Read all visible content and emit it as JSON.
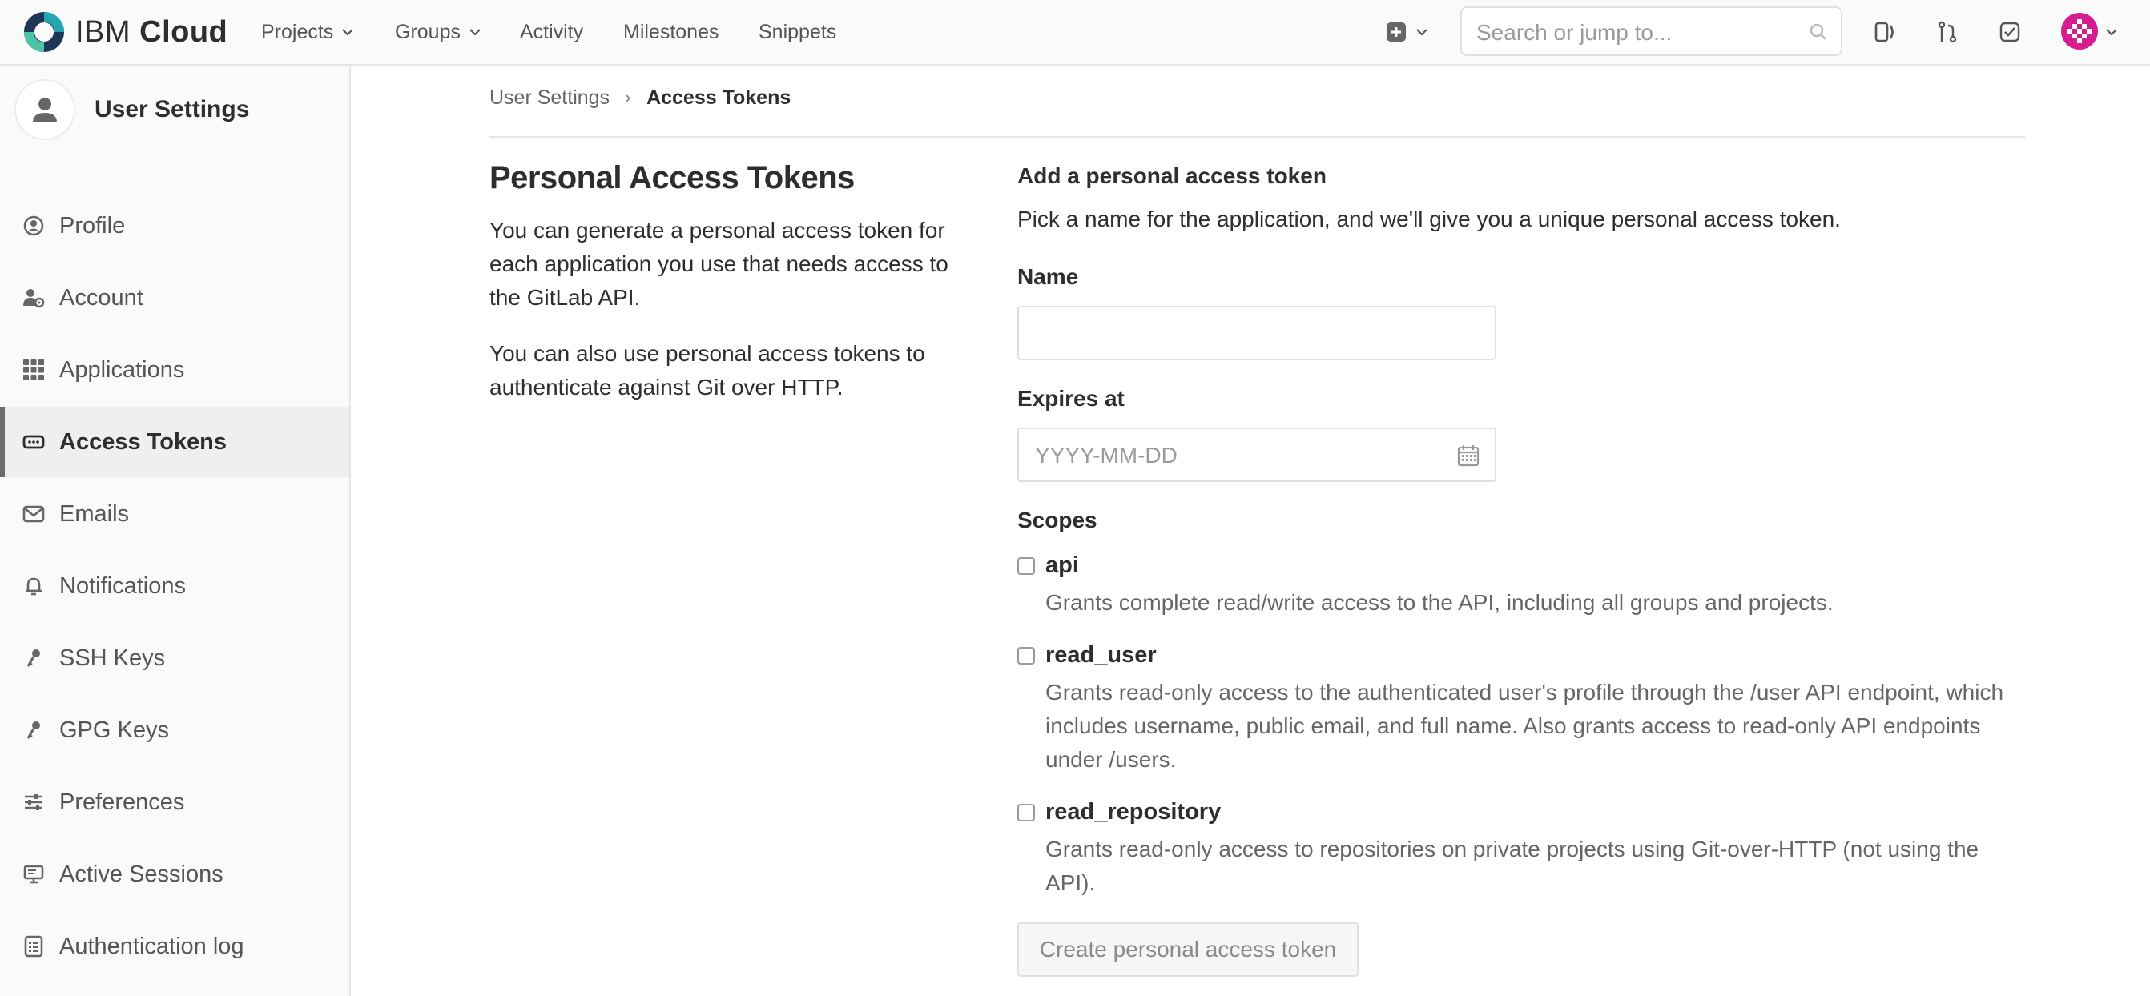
{
  "brand": {
    "name_ibm": "IBM",
    "name_cloud": "Cloud",
    "logo_icon": "ibm-cloud-logo"
  },
  "nav": {
    "projects": "Projects",
    "groups": "Groups",
    "activity": "Activity",
    "milestones": "Milestones",
    "snippets": "Snippets"
  },
  "search": {
    "placeholder": "Search or jump to..."
  },
  "sidebar": {
    "title": "User Settings",
    "items": [
      {
        "label": "Profile",
        "icon": "profile-icon"
      },
      {
        "label": "Account",
        "icon": "account-icon"
      },
      {
        "label": "Applications",
        "icon": "applications-icon"
      },
      {
        "label": "Access Tokens",
        "icon": "access-tokens-icon",
        "active": true
      },
      {
        "label": "Emails",
        "icon": "envelope-icon"
      },
      {
        "label": "Notifications",
        "icon": "bell-icon"
      },
      {
        "label": "SSH Keys",
        "icon": "key-icon"
      },
      {
        "label": "GPG Keys",
        "icon": "key-icon"
      },
      {
        "label": "Preferences",
        "icon": "sliders-icon"
      },
      {
        "label": "Active Sessions",
        "icon": "monitor-icon"
      },
      {
        "label": "Authentication log",
        "icon": "log-icon"
      }
    ]
  },
  "breadcrumb": {
    "parent": "User Settings",
    "current": "Access Tokens"
  },
  "intro": {
    "title": "Personal Access Tokens",
    "paragraph1": "You can generate a personal access token for each application you use that needs access to the GitLab API.",
    "paragraph2": "You can also use personal access tokens to authenticate against Git over HTTP."
  },
  "form": {
    "heading": "Add a personal access token",
    "subheading": "Pick a name for the application, and we'll give you a unique personal access token.",
    "name_label": "Name",
    "name_value": "",
    "expires_label": "Expires at",
    "expires_placeholder": "YYYY-MM-DD",
    "scopes_label": "Scopes",
    "scopes": [
      {
        "name": "api",
        "checked": false,
        "help": "Grants complete read/write access to the API, including all groups and projects."
      },
      {
        "name": "read_user",
        "checked": false,
        "help": "Grants read-only access to the authenticated user's profile through the /user API endpoint, which includes username, public email, and full name. Also grants access to read-only API endpoints under /users."
      },
      {
        "name": "read_repository",
        "checked": false,
        "help": "Grants read-only access to repositories on private projects using Git-over-HTTP (not using the API)."
      }
    ],
    "submit_label": "Create personal access token"
  },
  "colors": {
    "avatar_bg": "#d61d8f",
    "logo_teal": "#22a6b3",
    "logo_navy": "#1d3557"
  }
}
